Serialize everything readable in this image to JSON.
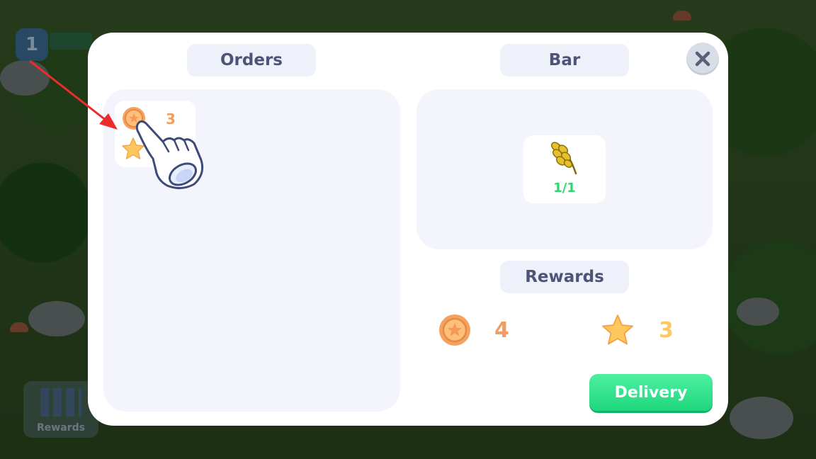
{
  "background": {
    "level": "1",
    "rewards_label": "Rewards"
  },
  "modal": {
    "orders_title": "Orders",
    "bar_title": "Bar",
    "rewards_title": "Rewards",
    "close_icon": "close-icon",
    "order_card": {
      "coin_icon": "coin-icon",
      "star_icon": "star-icon",
      "count": "3"
    },
    "bar_item": {
      "icon": "wheat-icon",
      "progress": "1/1"
    },
    "rewards": {
      "coins": "4",
      "stars": "3"
    },
    "delivery_label": "Delivery"
  },
  "tutorial": {
    "pointer_icon": "pointing-hand-icon",
    "arrow_icon": "red-arrow-icon"
  },
  "colors": {
    "accent_green": "#1ed77d",
    "coin_orange": "#f29c5f",
    "star_yellow": "#ffc75f",
    "progress_green": "#2fd56f",
    "title_text": "#4e5478"
  }
}
